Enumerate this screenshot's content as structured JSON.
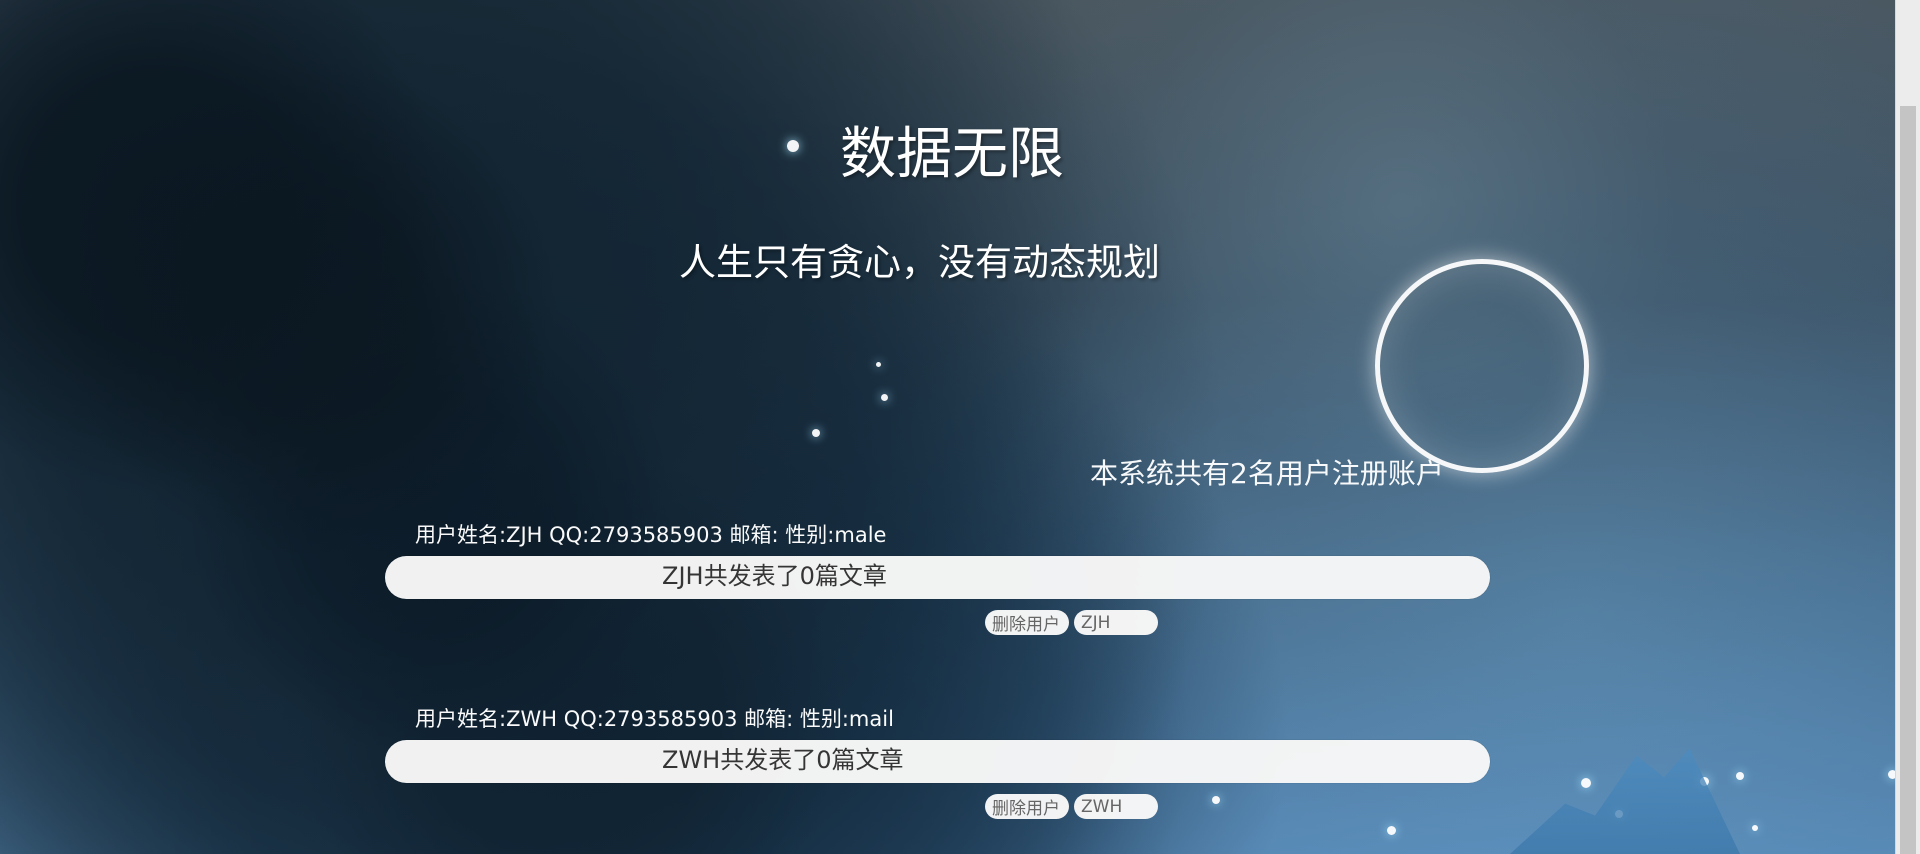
{
  "header": {
    "title": "数据无限",
    "subtitle": "人生只有贪心，没有动态规划"
  },
  "summary": {
    "text": "本系统共有2名用户注册账户"
  },
  "users": [
    {
      "meta": "用户姓名:ZJH QQ:2793585903 邮箱: 性别:male",
      "article_text": "ZJH共发表了0篇文章",
      "delete_label": "删除用户",
      "input_value": "ZJH"
    },
    {
      "meta": "用户姓名:ZWH QQ:2793585903 邮箱: 性别:mail",
      "article_text": "ZWH共发表了0篇文章",
      "delete_label": "删除用户",
      "input_value": "ZWH"
    }
  ],
  "decor": {
    "ring_icon": "eclipse-ring",
    "scrollbar_icon": "vertical-scrollbar"
  }
}
